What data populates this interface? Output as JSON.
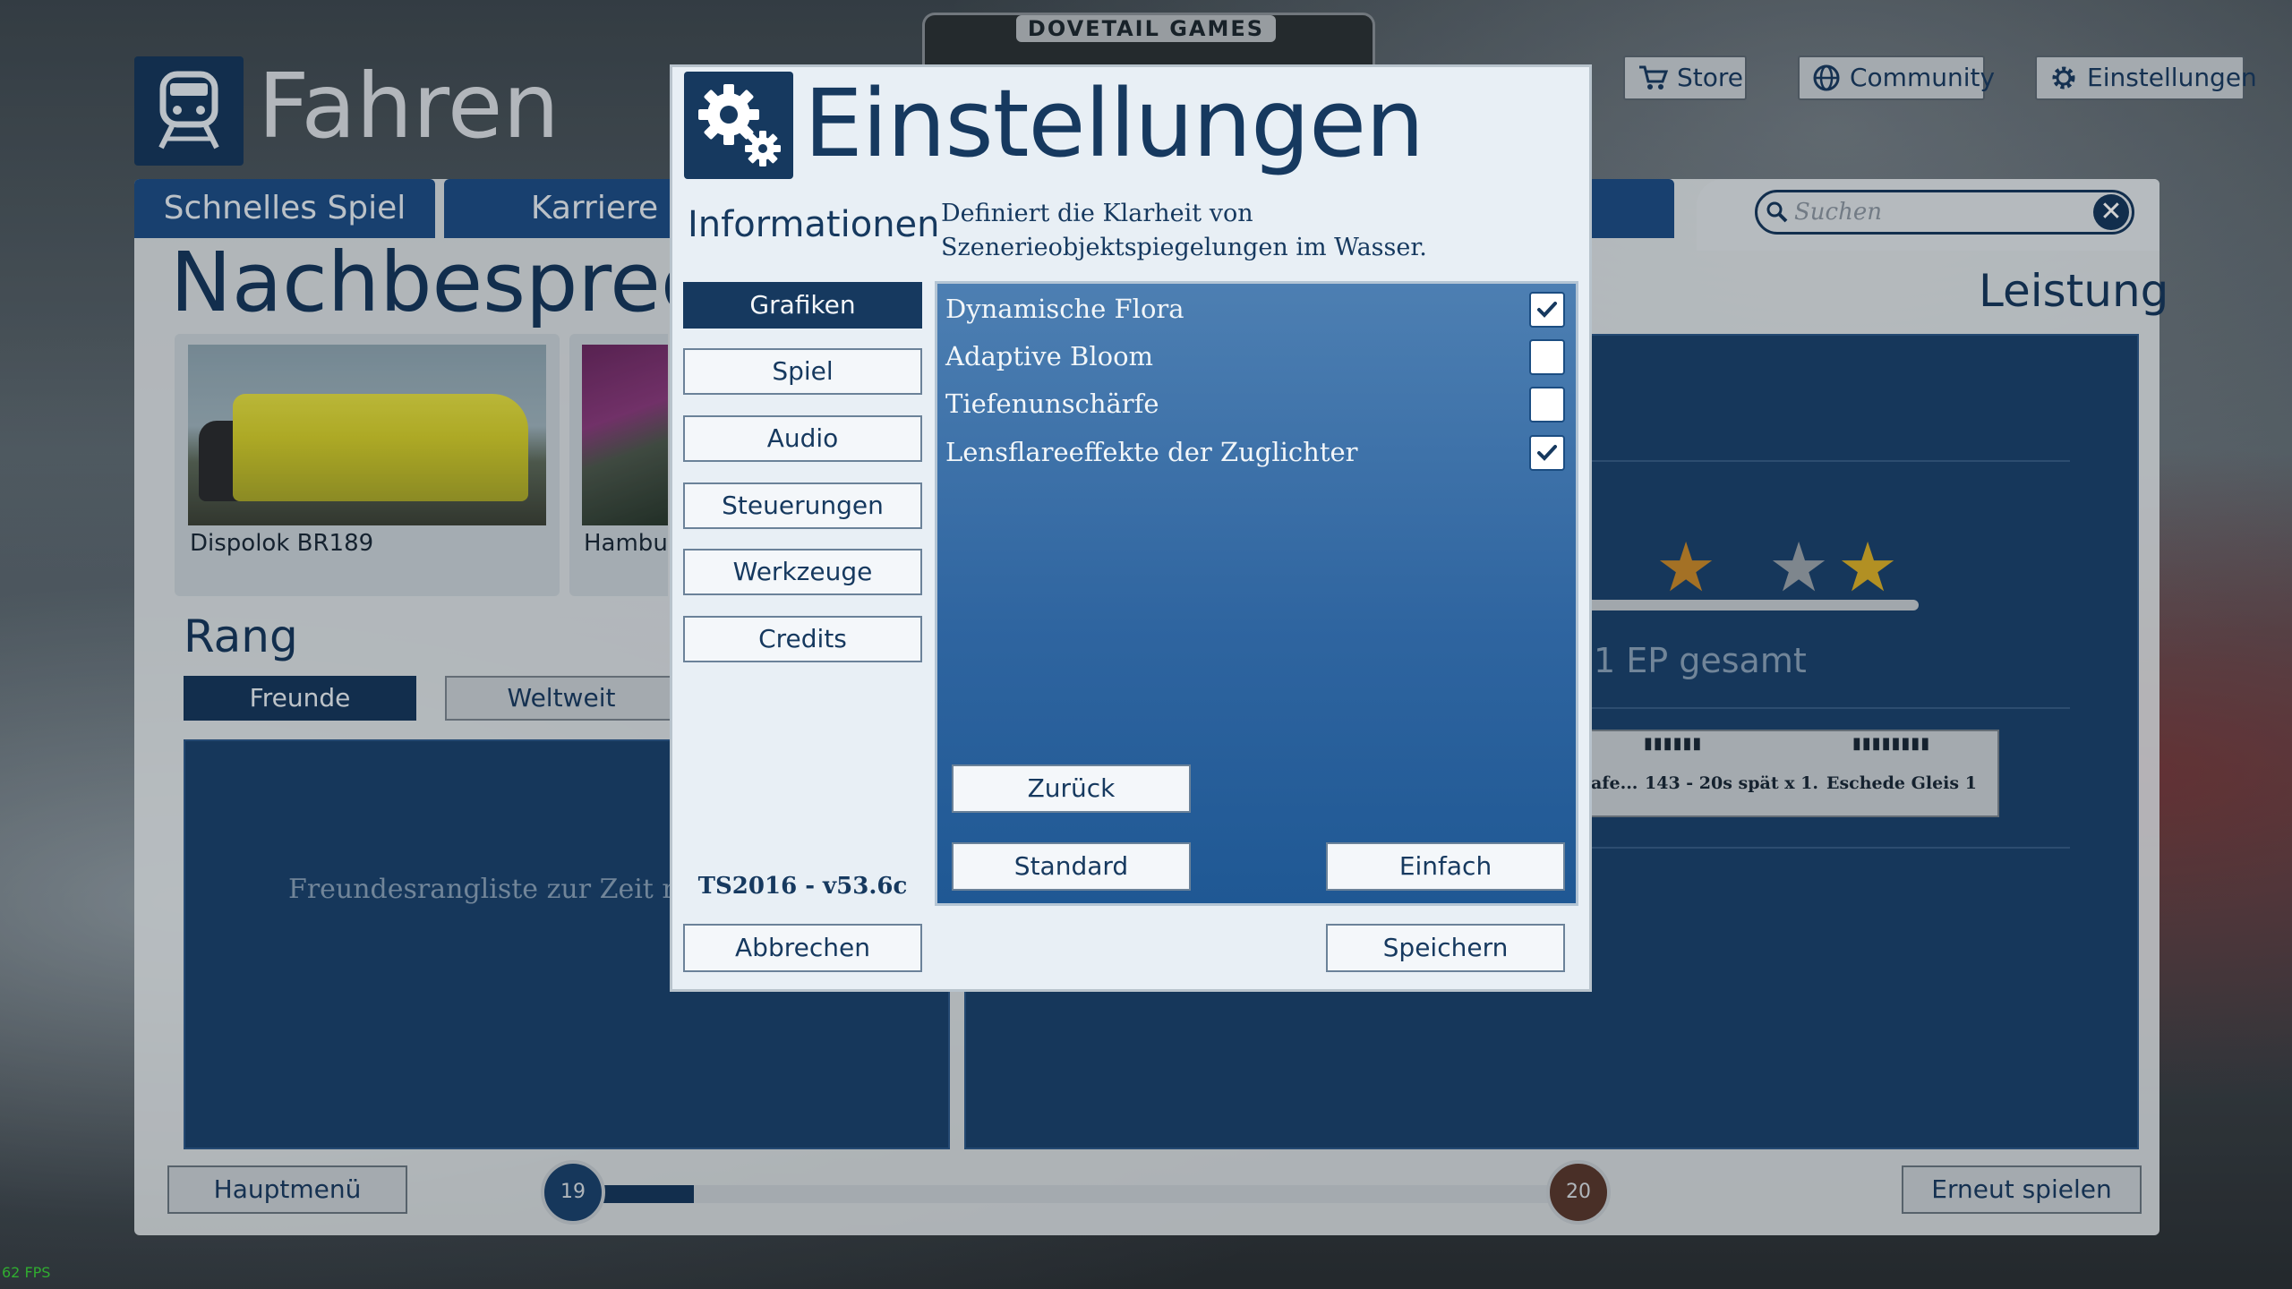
{
  "background": {
    "header": {
      "title": "Fahren"
    },
    "brand": "DOVETAIL GAMES",
    "top_buttons": {
      "store": "Store",
      "community": "Community",
      "settings": "Einstellungen"
    },
    "tabs": [
      "Schnelles Spiel",
      "Karriere"
    ],
    "page_heading": "Nachbesprech",
    "cards": [
      {
        "label": "Dispolok BR189"
      },
      {
        "label": "Hambur"
      }
    ],
    "rank": {
      "heading": "Rang",
      "tab_friends": "Freunde",
      "tab_world": "Weltweit",
      "empty_message": "Freundesrangliste zur Zeit nic"
    },
    "search": {
      "placeholder": "Suchen"
    },
    "performance": {
      "heading": "Leistung",
      "ep_total": "1 EP gesamt",
      "stars_filled": 2,
      "table": {
        "ticks_a": "▮▮▮▮▮▮",
        "ticks_b": "▮▮▮▮▮▮▮▮",
        "cells": [
          "afe...",
          "143 - 20s spät x 1.",
          "Eschede Gleis 1"
        ]
      }
    },
    "footer": {
      "main_menu": "Hauptmenü",
      "replay": "Erneut spielen",
      "level_current": "19",
      "level_next": "20",
      "progress_fraction": 0.12
    },
    "fps": "62 FPS"
  },
  "dialog": {
    "title": "Einstellungen",
    "info_heading": "Informationen",
    "description": "Definiert die Klarheit von Szenerieobjektspiegelungen im Wasser.",
    "nav": [
      {
        "label": "Grafiken",
        "active": true
      },
      {
        "label": "Spiel",
        "active": false
      },
      {
        "label": "Audio",
        "active": false
      },
      {
        "label": "Steuerungen",
        "active": false
      },
      {
        "label": "Werkzeuge",
        "active": false
      },
      {
        "label": "Credits",
        "active": false
      }
    ],
    "options": [
      {
        "label": "Dynamische Flora",
        "checked": true
      },
      {
        "label": "Adaptive Bloom",
        "checked": false
      },
      {
        "label": "Tiefenunschärfe",
        "checked": false
      },
      {
        "label": "Lensflareeffekte der Zuglichter",
        "checked": true
      }
    ],
    "panel_buttons": {
      "back": "Zurück",
      "default": "Standard",
      "simple": "Einfach"
    },
    "version": "TS2016 - v53.6c",
    "buttons": {
      "cancel": "Abbrechen",
      "save": "Speichern"
    }
  },
  "colors": {
    "navy": "#16395f",
    "panel_blue": "#2f65a0",
    "dialog_bg": "#e8eff5",
    "star_bronze": "#c98a2e",
    "star_silver": "#9aa4ad",
    "star_gold": "#d9b02b"
  }
}
